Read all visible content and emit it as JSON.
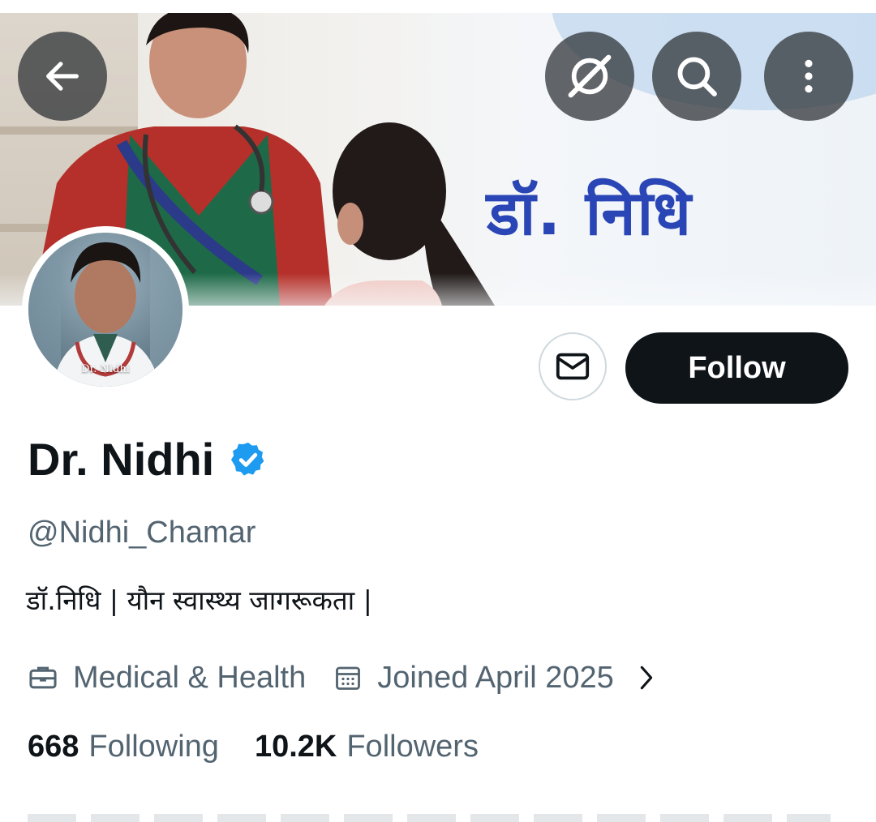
{
  "banner": {
    "title": "डॉ. निधि"
  },
  "top_buttons": {
    "back_icon": "arrow-left-icon",
    "grok_icon": "grok-icon",
    "search_icon": "search-icon",
    "more_icon": "more-vertical-icon"
  },
  "avatar": {
    "caption": "Dr. Nidhi"
  },
  "actions": {
    "message_icon": "envelope-icon",
    "follow_label": "Follow"
  },
  "profile": {
    "display_name": "Dr. Nidhi",
    "verified": true,
    "verified_color": "#1d9bf0",
    "handle": "@Nidhi_Chamar",
    "bio": "डॉ.निधि | यौन स्वास्थ्य जागरूकता |",
    "category": "Medical & Health",
    "joined": "Joined April 2025"
  },
  "stats": {
    "following_count": "668",
    "following_label": "Following",
    "followers_count": "10.2K",
    "followers_label": "Followers"
  },
  "colors": {
    "text_primary": "#0f1419",
    "text_secondary": "#536471",
    "banner_title": "#2a45b5"
  }
}
